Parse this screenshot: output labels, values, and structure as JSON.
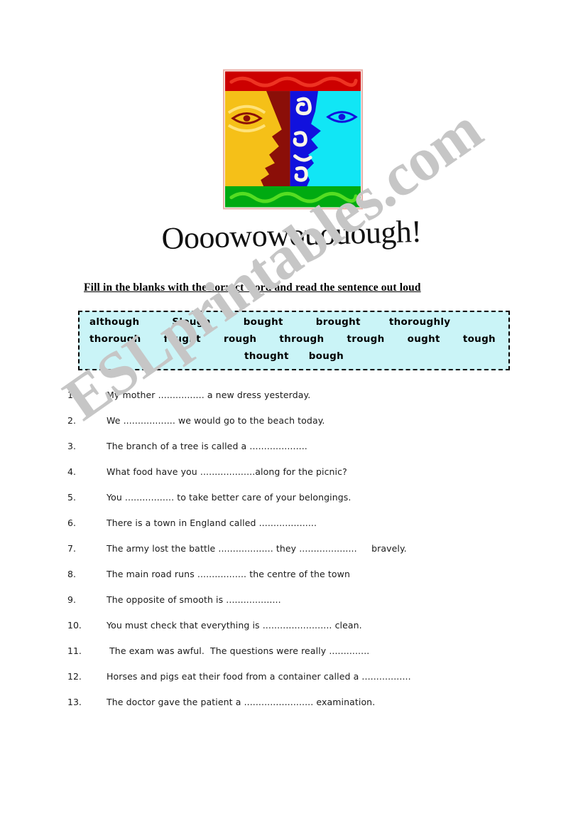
{
  "document": {
    "title": "Oooowowououough!",
    "instruction": "Fill in the blanks with the correct word and read the sentence out loud",
    "watermark": "ESLprintables.com"
  },
  "logo": {
    "name": "two-faces-profile-logo",
    "colors": {
      "top_band": "#cc0000",
      "top_wave": "#ee3322",
      "bottom_band": "#00aa11",
      "bottom_wave": "#55dd22",
      "left_panel": "#8b0f08",
      "left_face": "#f5c018",
      "left_eye_outline": "#8b0f08",
      "right_panel": "#1111dd",
      "right_face": "#11e6f5",
      "right_eye_outline": "#1111dd",
      "swirl": "#fbf7e6",
      "border": "#e8b0a8"
    }
  },
  "word_bank": {
    "background": "#caf4f7",
    "border_color": "#000000",
    "rows": [
      [
        "although",
        "Slough",
        "bought",
        "brought",
        "thoroughly"
      ],
      [
        "thorough",
        "fought",
        "rough",
        "through",
        "trough",
        "ought",
        "tough"
      ],
      [
        "thought",
        "bough"
      ]
    ]
  },
  "exercise": {
    "items": [
      {
        "number": "1.",
        "text": "My mother ................ a new dress yesterday."
      },
      {
        "number": "2.",
        "text": "We .................. we would go to the beach today."
      },
      {
        "number": "3.",
        "text": "The branch of a tree is called a ...................."
      },
      {
        "number": "4.",
        "text": "What food have you ...................along for the picnic?"
      },
      {
        "number": "5.",
        "text": "You ................. to take better care of your belongings."
      },
      {
        "number": "6.",
        "text": "There is a town in England called ...................."
      },
      {
        "number": "7.",
        "text": "The army lost the battle ................... they ....................     bravely."
      },
      {
        "number": "8.",
        "text": "The main road runs ................. the centre of the town"
      },
      {
        "number": "9.",
        "text": "The opposite of smooth is ..................."
      },
      {
        "number": "10.",
        "text": "You must check that everything is ........................ clean."
      },
      {
        "number": "11.",
        "text": " The exam was awful.  The questions were really .............."
      },
      {
        "number": "12.",
        "text": "Horses and pigs eat their food from a container called a ................."
      },
      {
        "number": "13.",
        "text": "The doctor gave the patient a ........................ examination."
      }
    ]
  }
}
